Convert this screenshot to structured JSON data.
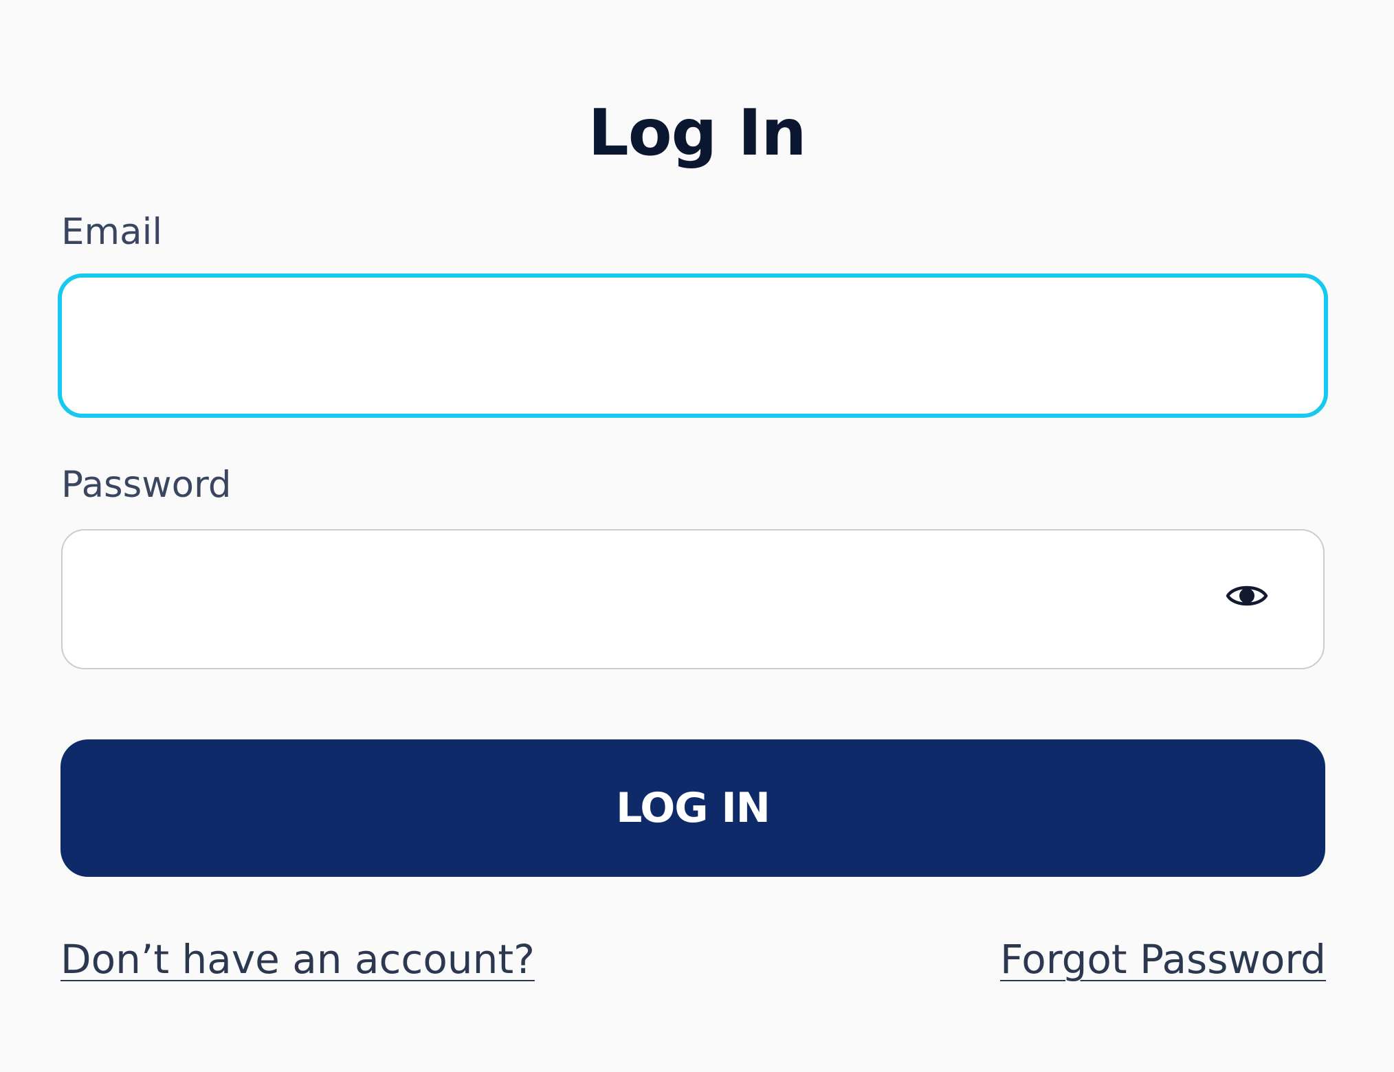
{
  "login": {
    "title": "Log In",
    "email_label": "Email",
    "email_value": "",
    "password_label": "Password",
    "password_value": "",
    "password_visibility_icon": "eye-icon",
    "submit_label": "LOG IN",
    "signup_link": "Don’t have an account?",
    "forgot_link": "Forgot Password"
  },
  "colors": {
    "background": "#fafafa",
    "focus_border": "#16c9ef",
    "button": "#0f2a69",
    "heading": "#0b1730",
    "label": "#3a4660"
  }
}
